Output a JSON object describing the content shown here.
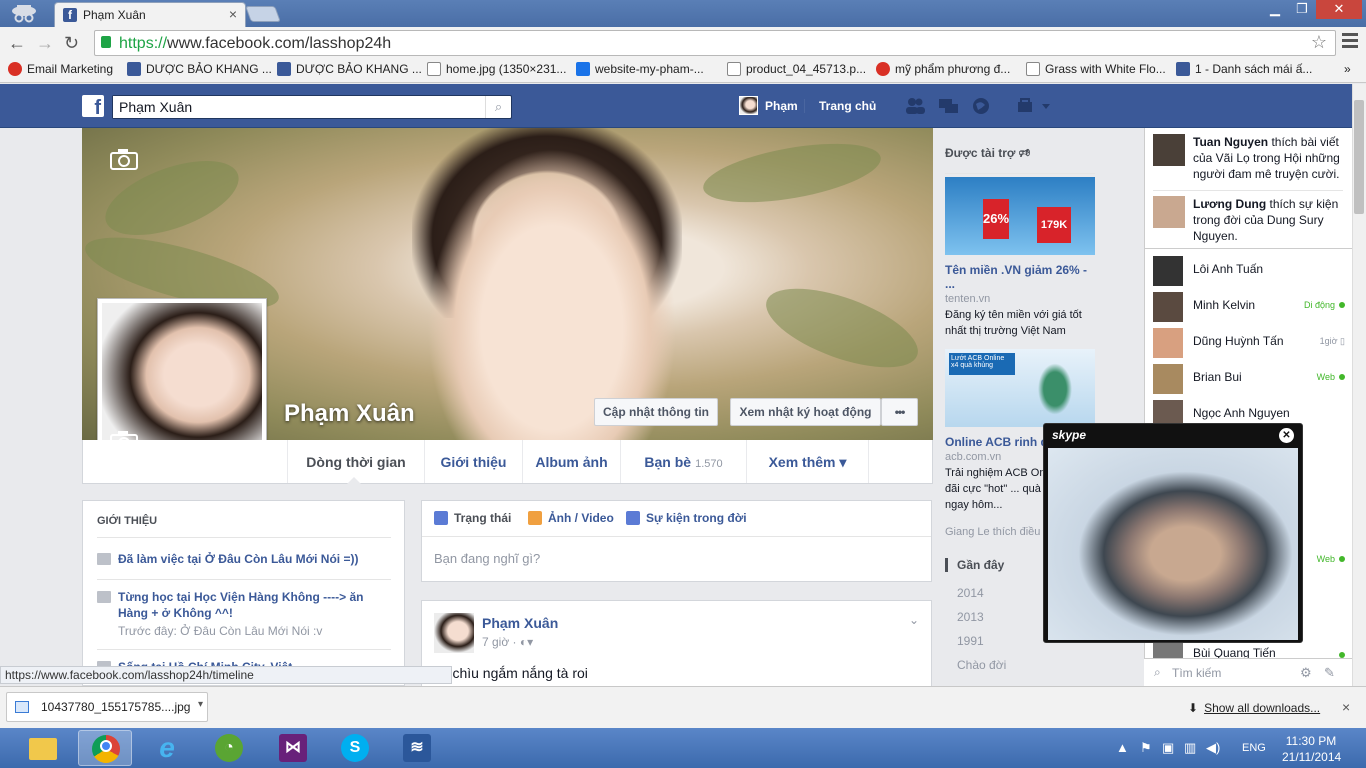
{
  "browser": {
    "tab_title": "Phạm Xuân",
    "url_scheme": "https://",
    "url_rest": "www.facebook.com/lasshop24h",
    "bookmarks": [
      {
        "label": "Email Marketing",
        "color": "#d93025"
      },
      {
        "label": "DƯỢC BẢO KHANG ...",
        "color": "#3b5998"
      },
      {
        "label": "DƯỢC BẢO KHANG ...",
        "color": "#3b5998"
      },
      {
        "label": "home.jpg (1350×231...",
        "color": "#ffffff"
      },
      {
        "label": "website-my-pham-...",
        "color": "#1a73e8"
      },
      {
        "label": "product_04_45713.p...",
        "color": "#ffffff"
      },
      {
        "label": "mỹ phẩm phương đ...",
        "color": "#d93025"
      },
      {
        "label": "Grass with White Flo...",
        "color": "#ffffff"
      },
      {
        "label": "1 - Danh sách mái ấ...",
        "color": "#3b5998"
      }
    ],
    "status_url": "https://www.facebook.com/lasshop24h/timeline"
  },
  "fb": {
    "search_value": "Phạm Xuân",
    "user_short": "Phạm",
    "home_label": "Trang chủ"
  },
  "profile": {
    "name": "Phạm Xuân",
    "update_info": "Cập nhật thông tin",
    "activity_log": "Xem nhật ký hoạt động",
    "more_dots": "•••",
    "tabs": [
      {
        "label": "Dòng thời gian",
        "count": ""
      },
      {
        "label": "Giới thiệu",
        "count": ""
      },
      {
        "label": "Album ảnh",
        "count": ""
      },
      {
        "label": "Bạn bè",
        "count": "1.570"
      },
      {
        "label": "Xem thêm ▾",
        "count": ""
      }
    ]
  },
  "intro": {
    "heading": "GIỚI THIỆU",
    "rows": [
      {
        "title": "Đã làm việc tại Ở Đâu Còn Lâu Mới Nói =))",
        "sub": ""
      },
      {
        "title": "Từng học tại Học Viện Hàng Không ----> ăn Hàng + ở Không ^^!",
        "sub": "Trước đây: Ở Đâu Còn Lâu Mới Nói :v"
      },
      {
        "title": "Sống tại Hồ Chí Minh City, Việt ...",
        "sub": ""
      }
    ]
  },
  "composer": {
    "status": "Trạng thái",
    "photo": "Ảnh / Video",
    "life_event": "Sự kiện trong đời",
    "placeholder": "Bạn đang nghĩ gì?"
  },
  "post": {
    "author": "Phạm Xuân",
    "time": "7 giờ · ◐▾",
    "text": "...iu chìu ngắm nắng tà roi"
  },
  "sponsored": {
    "heading": "Được tài trợ 🕫",
    "ads": [
      {
        "title": "Tên miền .VN giảm 26% - ...",
        "domain": "tenten.vn",
        "body": "Đăng ký tên miền với giá tốt nhất thị trường Việt Nam",
        "img_text": "26%  179K"
      },
      {
        "title": "Online ACB rinh qu...",
        "domain": "acb.com.vn",
        "body": "Trải nghiệm ACB Onl... các ưu đãi cực \"hot\" ... quà khủng ngay hôm...",
        "img_text": "Lướt ACB Online x4 quà khủng"
      }
    ],
    "like_line": "Giang Le thích điều n..."
  },
  "years": [
    "Gần đây",
    "2014",
    "2013",
    "1991",
    "Chào đời"
  ],
  "ticker": [
    {
      "name": "Tuan Nguyen",
      "text": " thích bài viết của Vãi Lọ trong Hội những người đam mê truyện cười."
    },
    {
      "name": "Lương Dung",
      "text": " thích sự kiện trong đời của Dung Sury Nguyen."
    }
  ],
  "chat": [
    {
      "name": "Lôi Anh Tuấn",
      "status": ""
    },
    {
      "name": "Minh Kelvin",
      "status": "Di động"
    },
    {
      "name": "Dũng Huỳnh Tấn",
      "status": "1giờ"
    },
    {
      "name": "Brian Bui",
      "status": "Web"
    },
    {
      "name": "Ngọc Anh Nguyen",
      "status": ""
    },
    {
      "name": "",
      "status": "Web"
    },
    {
      "name": "Bùi Quang Tiến",
      "status": ""
    }
  ],
  "chat_search_placeholder": "Tìm kiếm",
  "skype": {
    "logo": "skype"
  },
  "downloads": {
    "file": "10437780_155175785....jpg",
    "show_all": "Show all downloads..."
  },
  "taskbar": {
    "lang": "ENG",
    "time": "11:30 PM",
    "date": "21/11/2014"
  }
}
